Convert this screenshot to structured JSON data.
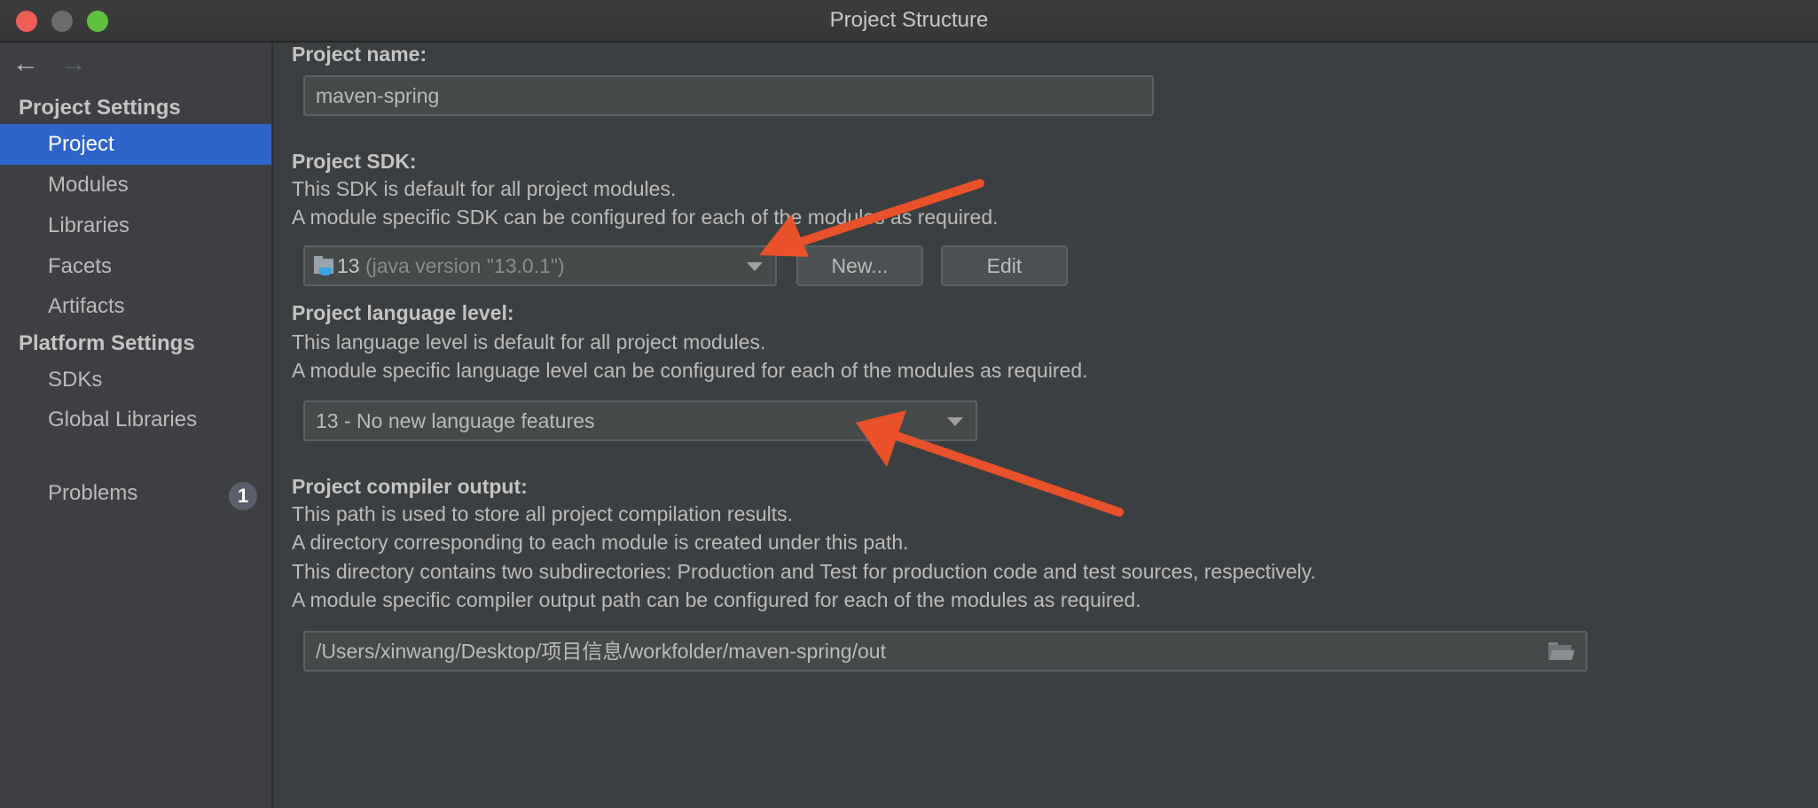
{
  "window": {
    "title": "Project Structure"
  },
  "sidebar": {
    "back_icon": "arrow-left",
    "forward_icon": "arrow-right",
    "groups": [
      {
        "label": "Project Settings"
      },
      {
        "label": "Platform Settings"
      }
    ],
    "items": [
      {
        "label": "Project",
        "selected": true
      },
      {
        "label": "Modules"
      },
      {
        "label": "Libraries"
      },
      {
        "label": "Facets"
      },
      {
        "label": "Artifacts"
      },
      {
        "label": "SDKs"
      },
      {
        "label": "Global Libraries"
      }
    ],
    "problems": {
      "label": "Problems",
      "count": "1"
    }
  },
  "main": {
    "name": {
      "label": "Project name:",
      "value": "maven-spring"
    },
    "sdk": {
      "label": "Project SDK:",
      "desc": [
        "This SDK is default for all project modules.",
        "A module specific SDK can be configured for each of the modules as required."
      ],
      "value_num": "13",
      "value_detail": "(java version \"13.0.1\")",
      "new_label": "New...",
      "edit_label": "Edit"
    },
    "language": {
      "label": "Project language level:",
      "desc": [
        "This language level is default for all project modules.",
        "A module specific language level can be configured for each of the modules as required."
      ],
      "value": "13 - No new language features"
    },
    "output": {
      "label": "Project compiler output:",
      "desc": [
        "This path is used to store all project compilation results.",
        "A directory corresponding to each module is created under this path.",
        "This directory contains two subdirectories: Production and Test for production code and test sources, respectively.",
        "A module specific compiler output path can be configured for each of the modules as required."
      ],
      "value": "/Users/xinwang/Desktop/项目信息/workfolder/maven-spring/out"
    }
  },
  "colors": {
    "accent": "#2f65ca",
    "annotation_arrow": "#e8512a"
  }
}
